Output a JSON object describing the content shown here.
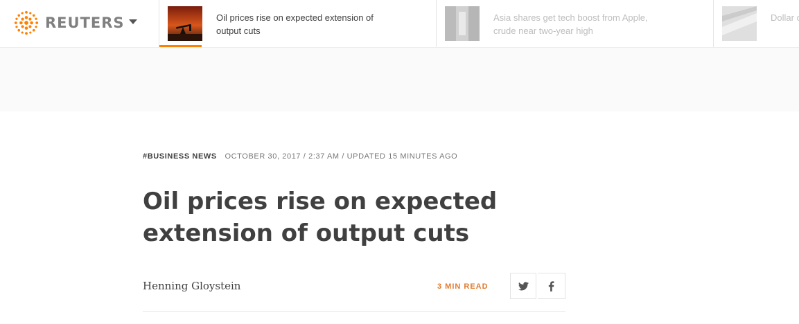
{
  "brand": {
    "name": "REUTERS",
    "accent": "#ff8000"
  },
  "nav": {
    "stories": [
      {
        "title": "Oil prices rise on expected extension of output cuts",
        "active": true
      },
      {
        "title": "Asia shares get tech boost from Apple, crude near two-year high",
        "active": false
      },
      {
        "title": "Dollar on pressure",
        "active": false
      }
    ]
  },
  "article": {
    "section": "#BUSINESS NEWS",
    "dateline": "OCTOBER 30, 2017 / 2:37 AM / UPDATED 15 MINUTES AGO",
    "headline": "Oil prices rise on expected extension of output cuts",
    "author": "Henning Gloystein",
    "read_time": "3 MIN READ"
  },
  "icons": {
    "menu": "chevron-down-icon",
    "share_twitter": "twitter-icon",
    "share_facebook": "facebook-icon"
  }
}
